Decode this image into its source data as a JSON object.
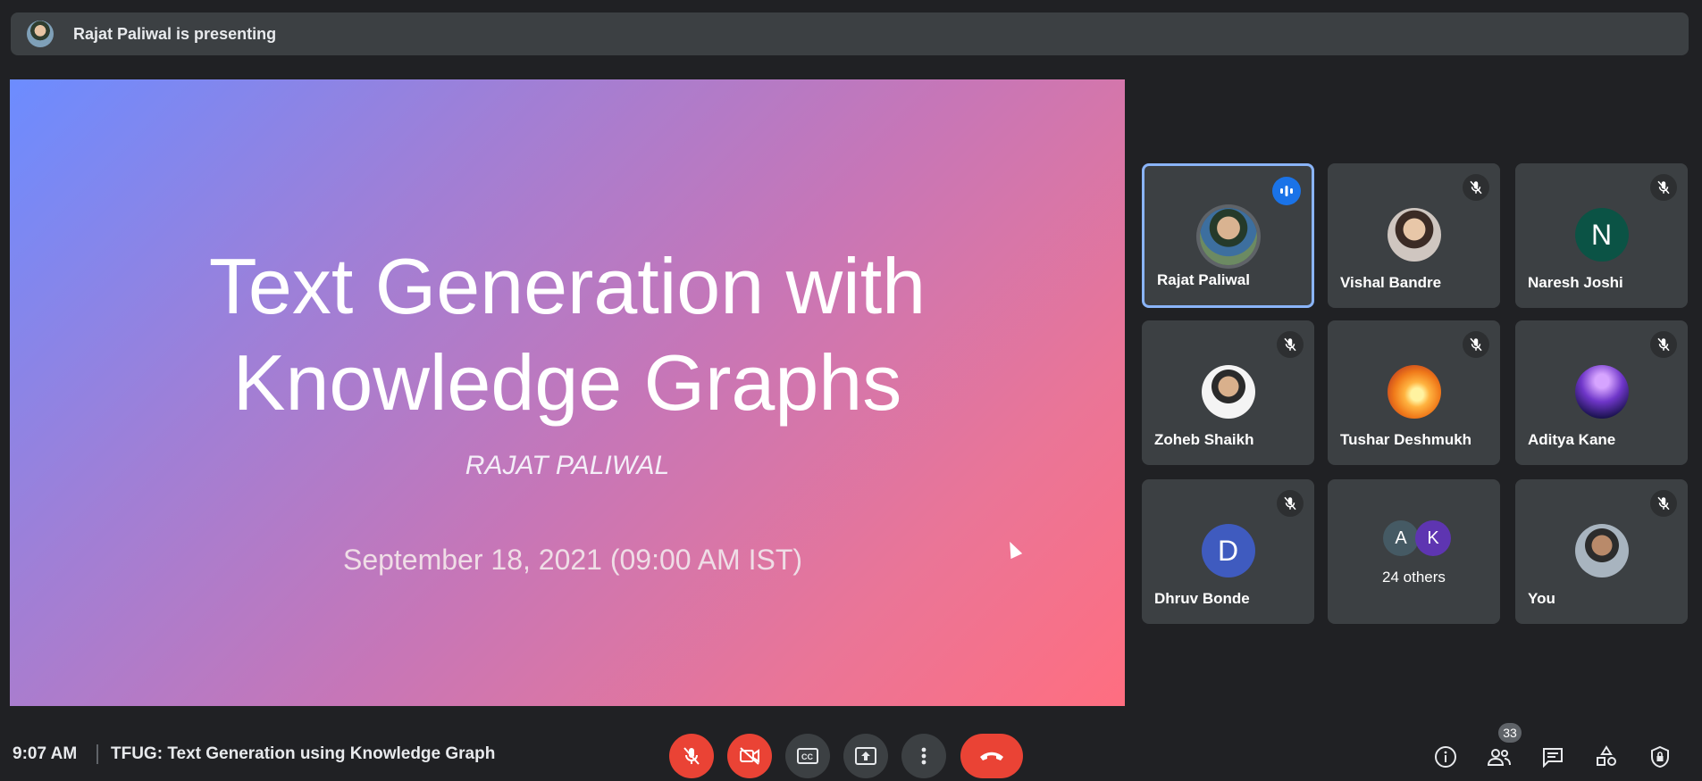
{
  "banner": {
    "text": "Rajat Paliwal is presenting"
  },
  "slide": {
    "title_line1": "Text Generation with",
    "title_line2": "Knowledge Graphs",
    "author": "RAJAT PALIWAL",
    "date": "September 18, 2021 (09:00 AM IST)"
  },
  "participants": [
    {
      "name": "Rajat Paliwal",
      "avatar_type": "photo",
      "speaking": true
    },
    {
      "name": "Vishal Bandre",
      "avatar_type": "photo",
      "muted": true
    },
    {
      "name": "Naresh Joshi",
      "avatar_letter": "N",
      "avatar_color": "#0b5345",
      "muted": true
    },
    {
      "name": "Zoheb Shaikh",
      "avatar_type": "photo",
      "muted": true
    },
    {
      "name": "Tushar Deshmukh",
      "avatar_type": "photo",
      "muted": true
    },
    {
      "name": "Aditya Kane",
      "avatar_type": "photo",
      "muted": true
    },
    {
      "name": "Dhruv Bonde",
      "avatar_letter": "D",
      "avatar_color": "#3f5bbf",
      "muted": true
    },
    {
      "name": "You",
      "avatar_type": "photo",
      "muted": true
    }
  ],
  "others": {
    "letters": [
      "A",
      "K"
    ],
    "colors": [
      "#455a64",
      "#5e35b1"
    ],
    "label": "24 others"
  },
  "footer": {
    "time": "9:07 AM",
    "meeting_title": "TFUG: Text Generation using Knowledge Graph",
    "people_count": "33"
  },
  "controls": [
    "mic-off-icon",
    "camera-off-icon",
    "captions-icon",
    "present-icon",
    "more-options-icon",
    "end-call-icon"
  ],
  "right_controls": [
    "info-icon",
    "people-icon",
    "chat-icon",
    "activities-icon",
    "host-controls-icon"
  ]
}
